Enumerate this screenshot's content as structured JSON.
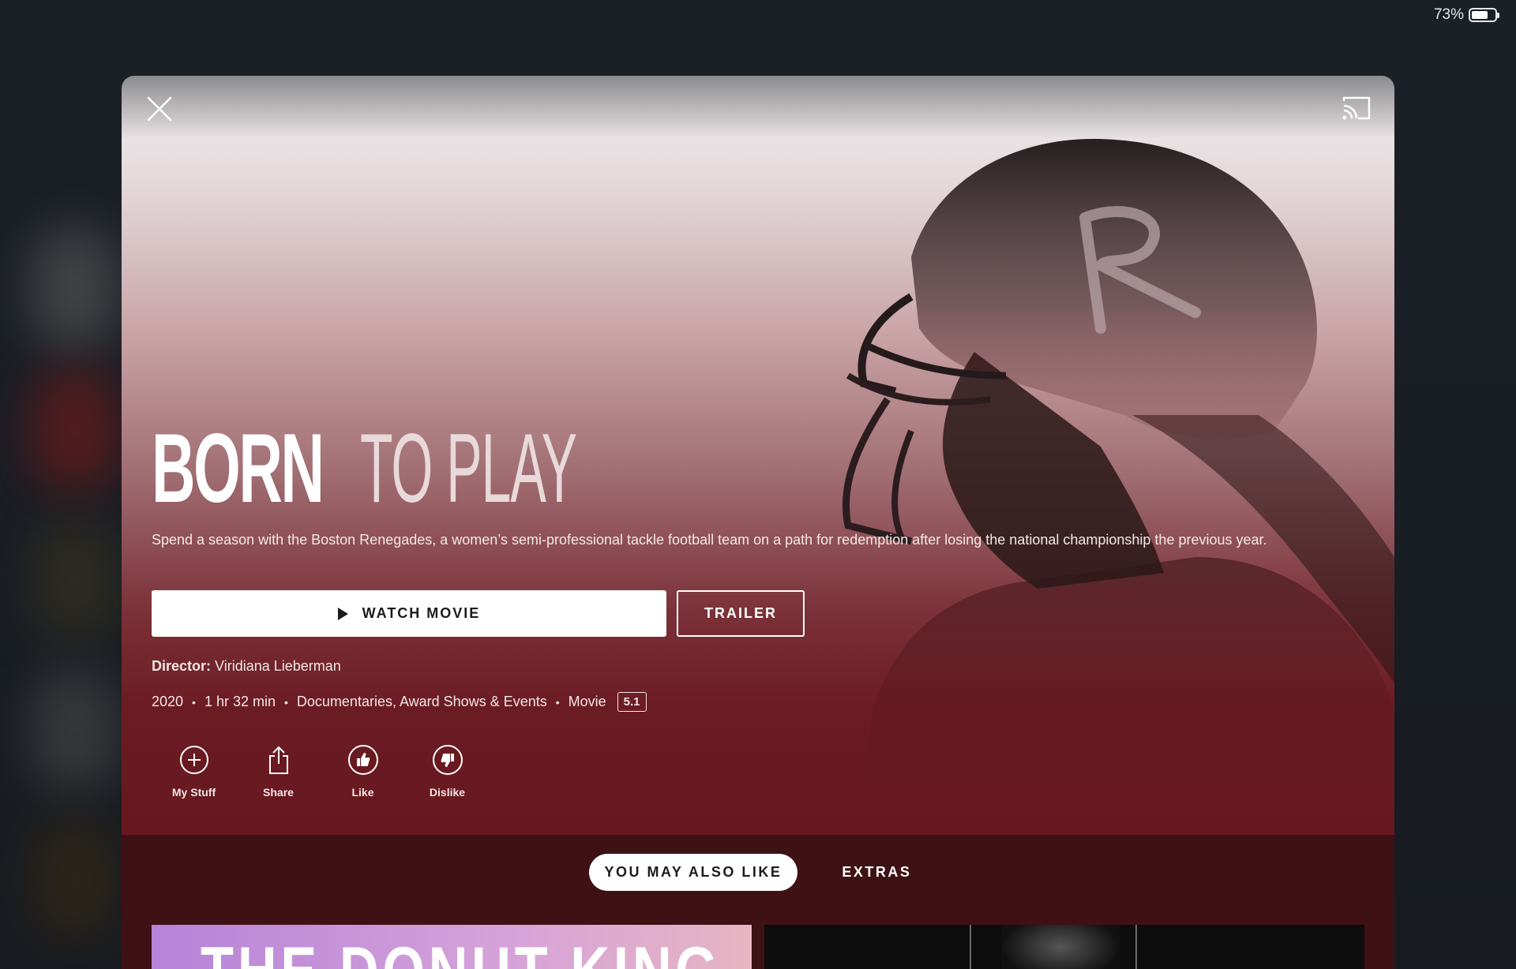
{
  "status_bar": {
    "battery_percent": "73%",
    "battery_level": 0.73
  },
  "modal": {
    "title_bold": "BORN",
    "title_light": "TO PLAY",
    "description": "Spend a season with the Boston Renegades, a women’s semi-professional tackle football team on a path for redemption after losing the national championship the previous year.",
    "watch_label": "WATCH MOVIE",
    "trailer_label": "TRAILER",
    "director_label": "Director:",
    "director_name": "Viridiana Lieberman",
    "meta": {
      "year": "2020",
      "duration": "1 hr 32 min",
      "genres": "Documentaries, Award Shows & Events",
      "type": "Movie",
      "audio_badge": "5.1",
      "separator": "•"
    },
    "actions": [
      {
        "label": "My Stuff",
        "icon": "plus-circle-icon"
      },
      {
        "label": "Share",
        "icon": "share-icon"
      },
      {
        "label": "Like",
        "icon": "thumbs-up-icon"
      },
      {
        "label": "Dislike",
        "icon": "thumbs-down-icon"
      }
    ],
    "tabs": [
      {
        "label": "YOU MAY ALSO LIKE",
        "active": true
      },
      {
        "label": "EXTRAS",
        "active": false
      }
    ],
    "thumbnails": [
      {
        "title": "THE DONUT KING"
      },
      {
        "title": ""
      }
    ]
  },
  "colors": {
    "hero_top": "#e8e2e4",
    "hero_bottom": "#66181e",
    "lower_bg": "#3e1115",
    "accent_white": "#ffffff"
  }
}
